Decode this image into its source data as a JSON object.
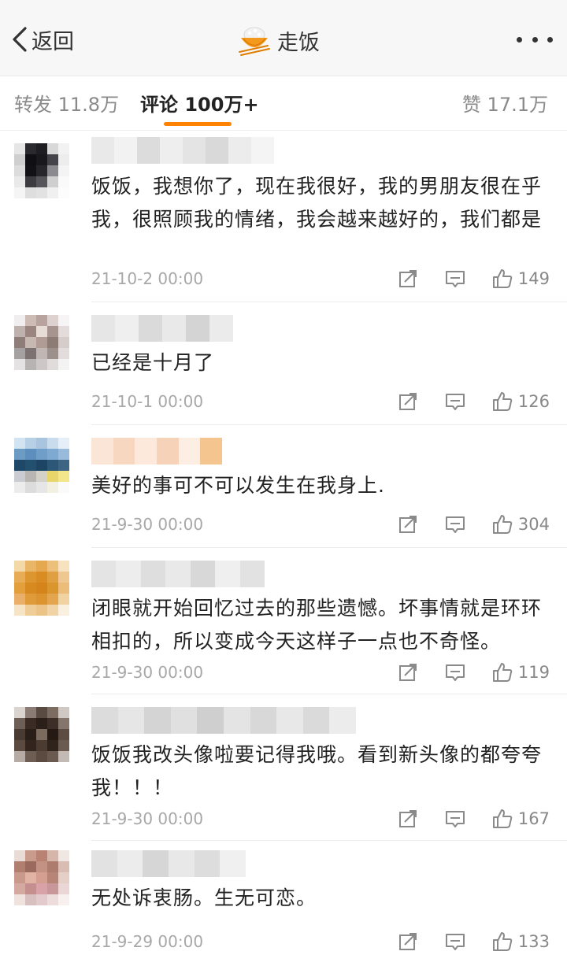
{
  "nav": {
    "back_label": "返回",
    "title": "走饭",
    "more_icon": "more-dots-icon",
    "title_icon": "rice-bowl-icon"
  },
  "tabs": {
    "repost": "转发 11.8万",
    "comment": "评论 100万+",
    "like": "赞 17.1万",
    "accent_color": "#ff8200"
  },
  "comments": [
    {
      "text": "饭饭，我想你了，现在我很好，我的男朋友很在乎我，很照顾我的情绪，我会越来越好的，我们都是",
      "time": "21-10-2 00:00",
      "likes": "149"
    },
    {
      "text": "已经是十月了",
      "time": "21-10-1 00:00",
      "likes": "126"
    },
    {
      "text": "美好的事可不可以发生在我身上.",
      "time": "21-9-30 00:00",
      "likes": "304"
    },
    {
      "text": "闭眼就开始回忆过去的那些遗憾。坏事情就是环环相扣的，所以变成今天这样子一点也不奇怪。",
      "time": "21-9-30 00:00",
      "likes": "119"
    },
    {
      "text": "饭饭我改头像啦要记得我哦。看到新头像的都夸夸我！！！",
      "time": "21-9-30 00:00",
      "likes": "167"
    },
    {
      "text": "无处诉衷肠。生无可恋。",
      "time": "21-9-29 00:00",
      "likes": "133"
    }
  ]
}
